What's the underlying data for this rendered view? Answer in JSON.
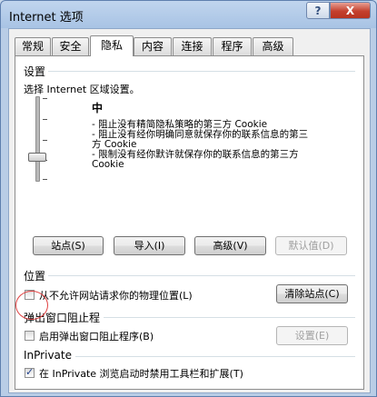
{
  "window": {
    "title": "Internet 选项",
    "help_label": "?",
    "close_label": "X"
  },
  "tabs": [
    "常规",
    "安全",
    "隐私",
    "内容",
    "连接",
    "程序",
    "高级"
  ],
  "active_tab": "隐私",
  "settings": {
    "heading": "设置",
    "instruction": "选择 Internet 区域设置。",
    "level": "中",
    "lines": [
      "- 阻止没有精简隐私策略的第三方 Cookie",
      "- 阻止没有经你明确同意就保存你的联系信息的第三",
      "方 Cookie",
      "- 限制没有经你默许就保存你的联系信息的第三方",
      "Cookie"
    ],
    "buttons": {
      "sites": "站点(S)",
      "import": "导入(I)",
      "advanced": "高级(V)",
      "default": "默认值(D)"
    }
  },
  "location": {
    "heading": "位置",
    "checkbox_label": "从不允许网站请求你的物理位置(L)",
    "checked": false,
    "clear_button": "清除站点(C)"
  },
  "popup_blocker": {
    "heading": "弹出窗口阻止程",
    "checkbox_label": "启用弹出窗口阻止程序(B)",
    "checked": false,
    "settings_button": "设置(E)"
  },
  "inprivate": {
    "heading": "InPrivate",
    "checkbox_label": "在 InPrivate 浏览启动时禁用工具栏和扩展(T)",
    "checked": true
  },
  "colors": {
    "annotation": "#e04040",
    "title_bar": "#a8c3e4",
    "close": "#c4402e"
  }
}
